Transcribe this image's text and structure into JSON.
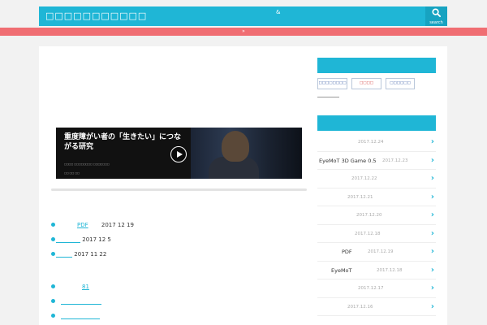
{
  "header": {
    "site_title": "□□□□□□□□□□□□□□□□□□□□□",
    "mark": "&",
    "search_label": "search"
  },
  "notice": {
    "text": "»"
  },
  "video": {
    "title": "重度障がい者の「生きたい」につながる研究",
    "subtitle": "□□□□ □□□□□□□□ □□□□□□□",
    "credit": "□□ □□ □□"
  },
  "list_a": [
    {
      "link": "PDF",
      "text": "2017 12 19"
    },
    {
      "link": "",
      "text": "2017 12 5"
    },
    {
      "link": "",
      "text": "2017 11 22"
    }
  ],
  "list_b": [
    {
      "link": "81",
      "text": ""
    },
    {
      "link": "",
      "text": ""
    },
    {
      "link": "",
      "text": ""
    }
  ],
  "sidebar": {
    "banners": [
      "□□□□□□□□",
      "□□□□",
      "□□□□□□"
    ],
    "recent": [
      {
        "text": "",
        "date": "2017.12.24"
      },
      {
        "text": "EyeMoT 3D Game 0.5",
        "date": "2017.12.23"
      },
      {
        "text": "",
        "date": "2017.12.22"
      },
      {
        "text": "",
        "date": "2017.12.21"
      },
      {
        "text": "",
        "date": "2017.12.20"
      },
      {
        "text": "",
        "date": "2017.12.18"
      },
      {
        "text": "PDF",
        "date": "2017.12.19"
      },
      {
        "text": "EyeMoT",
        "date": "2017.12.18"
      },
      {
        "text": "",
        "date": "2017.12.17"
      },
      {
        "text": "",
        "date": "2017.12.16"
      }
    ],
    "chevron": "›"
  },
  "colors": {
    "accent": "#1fb6d6",
    "notice": "#f06e73"
  }
}
